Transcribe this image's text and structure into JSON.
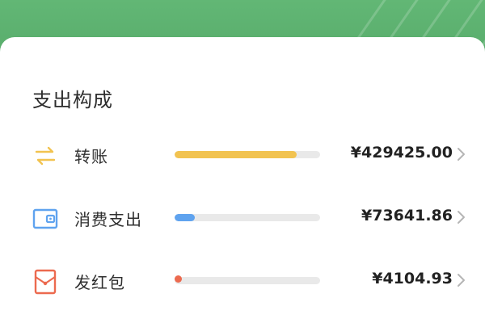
{
  "section": {
    "title": "支出构成"
  },
  "items": [
    {
      "label": "转账",
      "amount": "¥429425.00",
      "ratio": 0.84,
      "color": "#f2c350",
      "icon": "transfer-arrows-icon"
    },
    {
      "label": "消费支出",
      "amount": "¥73641.86",
      "ratio": 0.14,
      "color": "#5fa3ef",
      "icon": "wallet-icon"
    },
    {
      "label": "发红包",
      "amount": "¥4104.93",
      "ratio": 0.02,
      "color": "#ec6a4f",
      "icon": "red-envelope-icon"
    }
  ],
  "colors": {
    "header_green": "#5cb06f",
    "track_gray": "#e9e9e9"
  }
}
